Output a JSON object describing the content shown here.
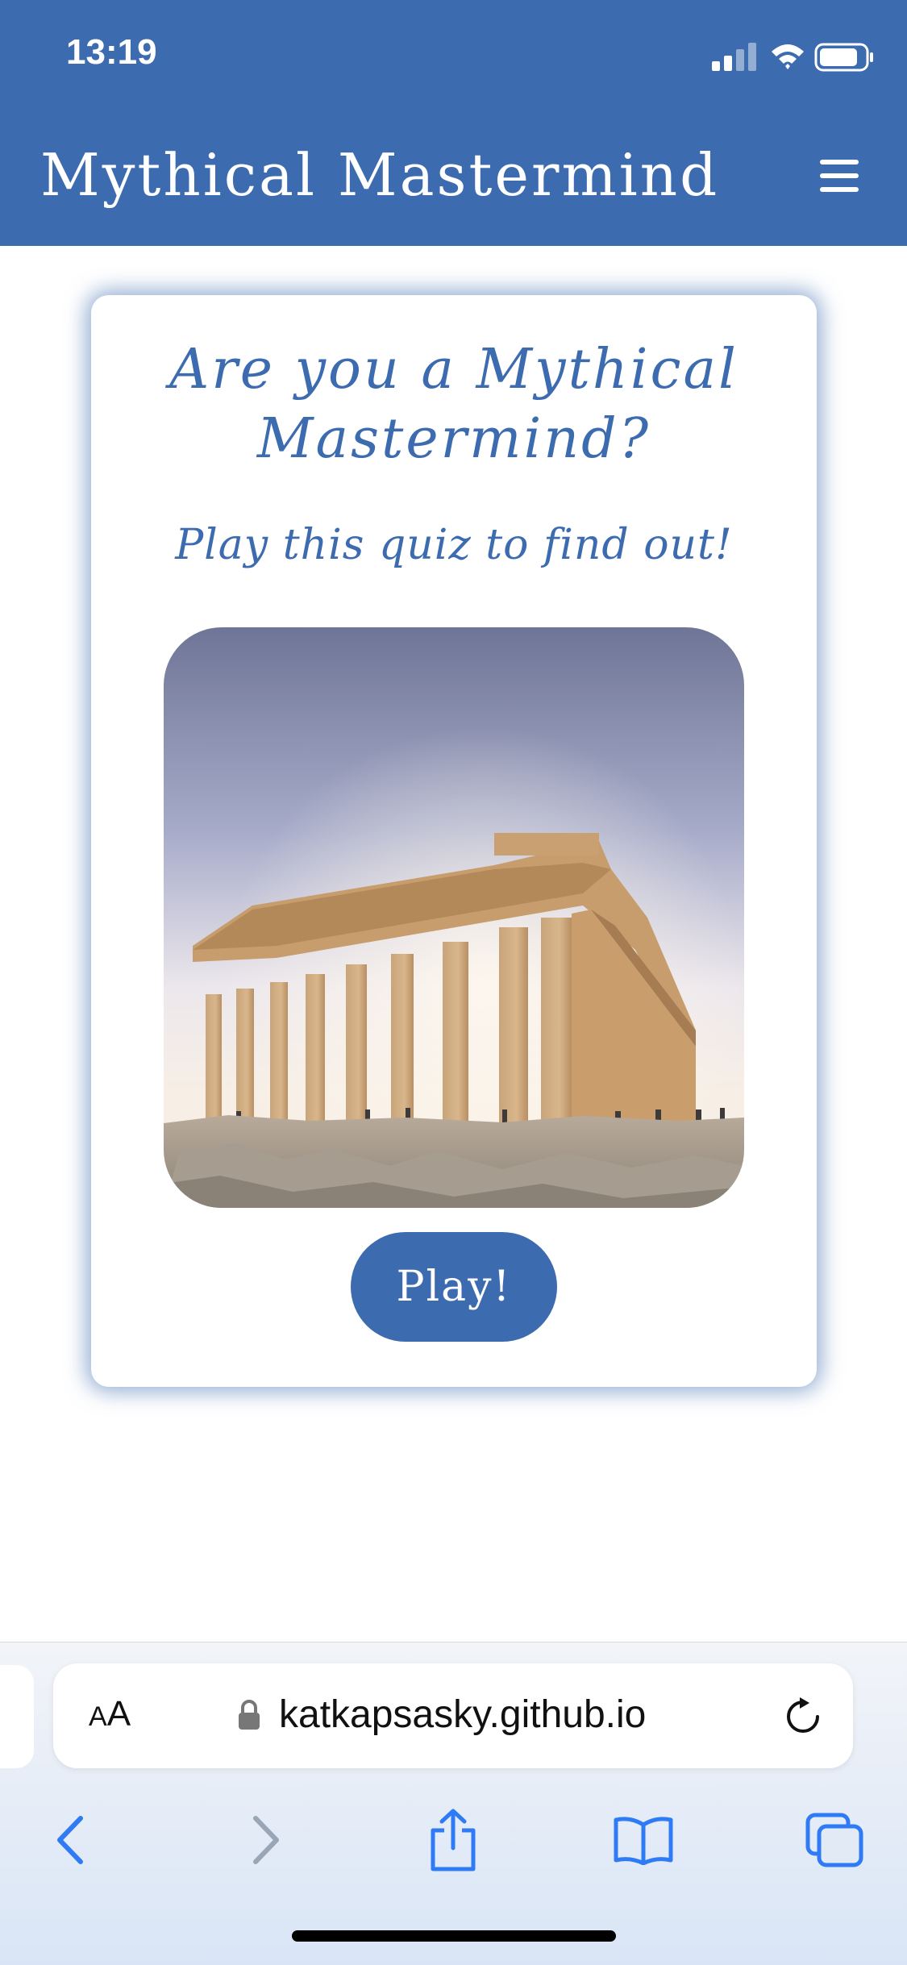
{
  "status_bar": {
    "time": "13:19"
  },
  "header": {
    "title": "Mythical Mastermind",
    "menu_icon": "hamburger-menu-icon"
  },
  "card": {
    "title_line1": "Are you a Mythical",
    "title_line2": "Mastermind?",
    "subtitle": "Play this quiz to find out!",
    "image": "parthenon-photo",
    "play_label": "Play!"
  },
  "browser": {
    "aa_small": "A",
    "aa_large": "A",
    "url": "katkapsasky.github.io",
    "icons": [
      "back-icon",
      "forward-icon",
      "share-icon",
      "bookmarks-icon",
      "tabs-icon",
      "reload-icon",
      "lock-icon"
    ]
  },
  "colors": {
    "brand": "#3d6baf",
    "background": "#ffffff"
  }
}
